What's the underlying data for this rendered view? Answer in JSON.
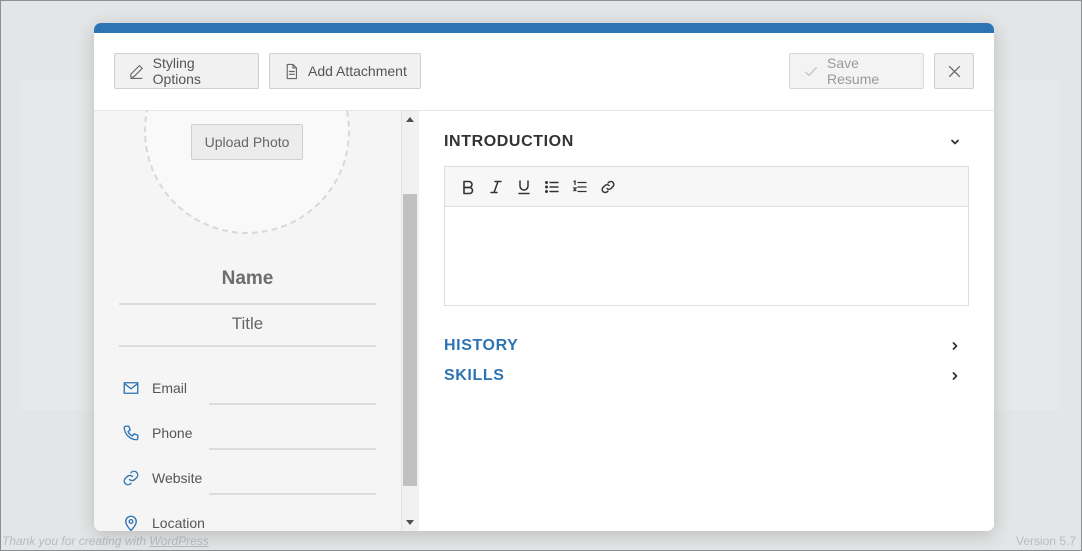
{
  "background": {
    "footer_text": "Thank you for creating with ",
    "footer_link": "WordPress",
    "version_text": "Version 5.7"
  },
  "header": {
    "styling_label": "Styling Options",
    "attachment_label": "Add Attachment",
    "save_label": "Save Resume",
    "close_icon": "close-icon"
  },
  "profile": {
    "upload_label": "Upload Photo",
    "name_placeholder": "Name",
    "title_placeholder": "Title",
    "contacts": [
      {
        "label": "Email",
        "icon": "mail-icon"
      },
      {
        "label": "Phone",
        "icon": "phone-icon"
      },
      {
        "label": "Website",
        "icon": "link-icon"
      },
      {
        "label": "Location",
        "icon": "location-pin-icon"
      }
    ]
  },
  "sections": {
    "introduction": "INTRODUCTION",
    "history": "HISTORY",
    "skills": "SKILLS"
  },
  "editor": {
    "tools": [
      "bold-icon",
      "italic-icon",
      "underline-icon",
      "bullet-list-icon",
      "numbered-list-icon",
      "link-icon"
    ]
  },
  "colors": {
    "accent": "#2c74b3",
    "section_text": "#333333"
  }
}
